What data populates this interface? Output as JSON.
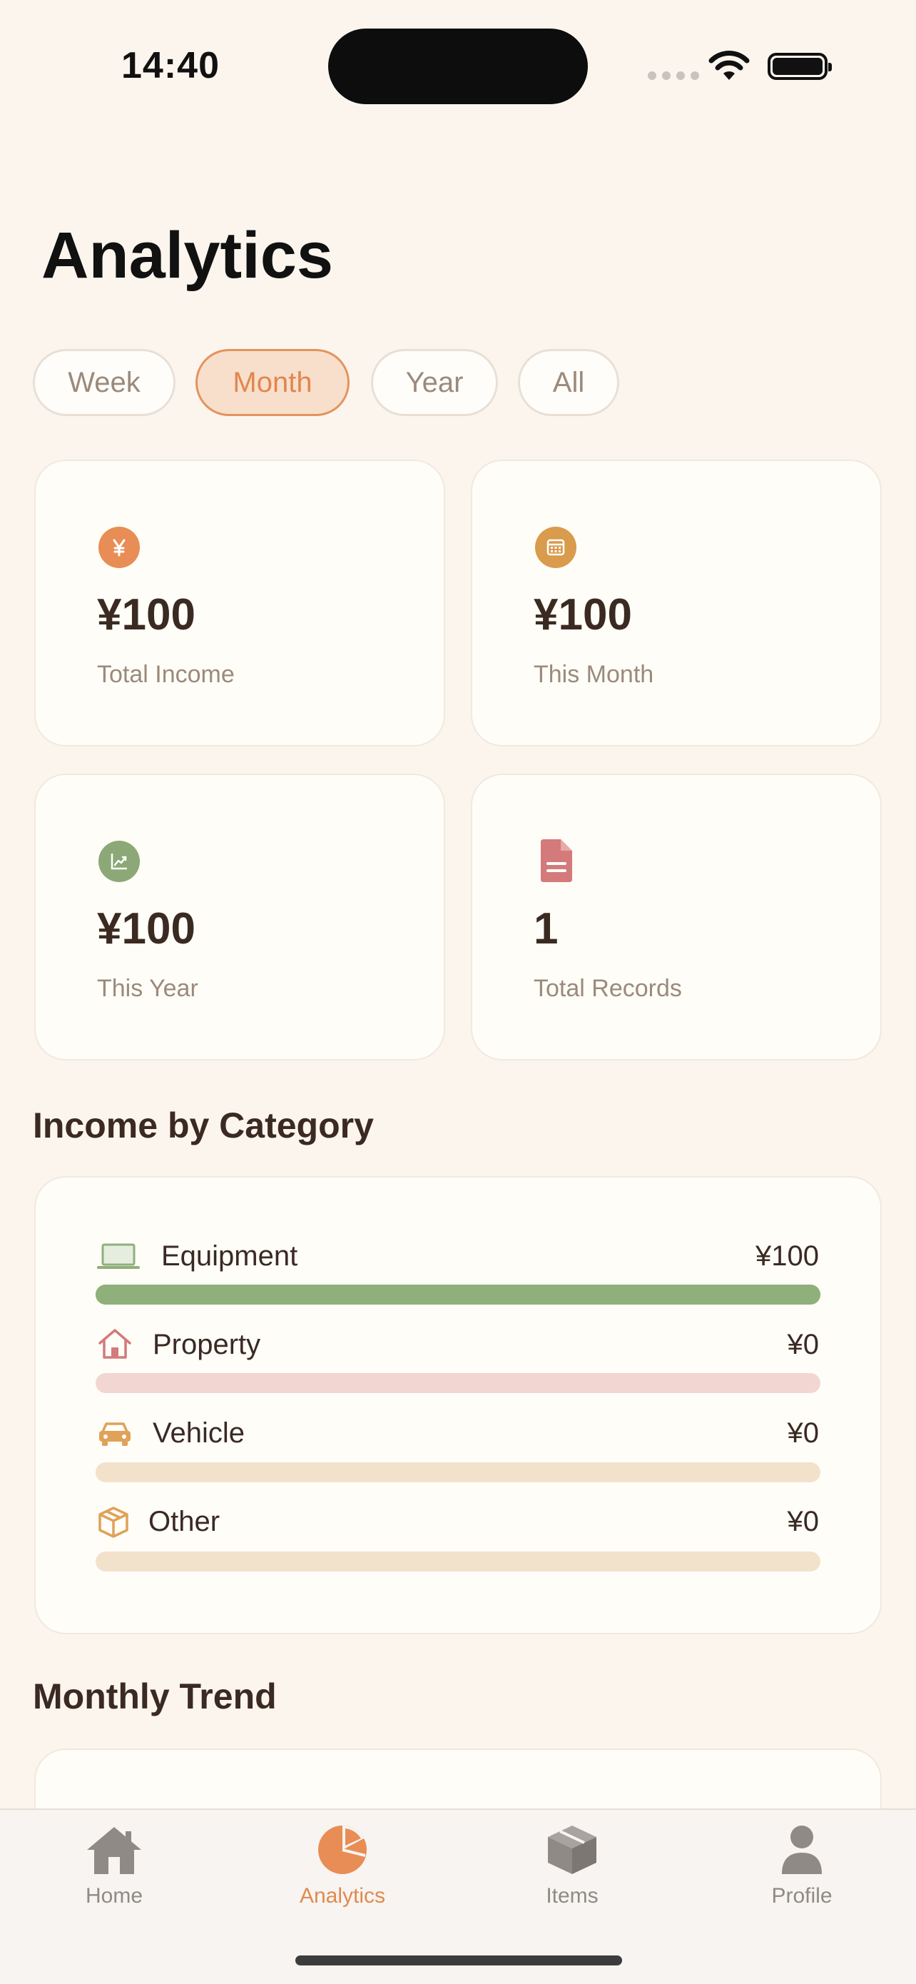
{
  "status_bar": {
    "time": "14:40"
  },
  "page": {
    "title": "Analytics"
  },
  "filters": [
    {
      "label": "Week",
      "selected": false
    },
    {
      "label": "Month",
      "selected": true
    },
    {
      "label": "Year",
      "selected": false
    },
    {
      "label": "All",
      "selected": false
    }
  ],
  "stats": [
    {
      "value": "¥100",
      "label": "Total Income",
      "icon": "yen-icon",
      "color": "#e88d55"
    },
    {
      "value": "¥100",
      "label": "This Month",
      "icon": "calendar-icon",
      "color": "#d99b4c"
    },
    {
      "value": "¥100",
      "label": "This Year",
      "icon": "trend-chart-icon",
      "color": "#8ba876"
    },
    {
      "value": "1",
      "label": "Total Records",
      "icon": "document-icon",
      "color": "#d47a7a"
    }
  ],
  "income_by_category": {
    "title": "Income by Category",
    "items": [
      {
        "name": "Equipment",
        "value": "¥100",
        "fraction": 1.0,
        "icon": "laptop-icon",
        "color": "#8fb07a",
        "track": "#8fb07a"
      },
      {
        "name": "Property",
        "value": "¥0",
        "fraction": 0.0,
        "icon": "house-icon",
        "color": "#d47a7a",
        "track": "#f1d6d2"
      },
      {
        "name": "Vehicle",
        "value": "¥0",
        "fraction": 0.0,
        "icon": "car-icon",
        "color": "#dfa258",
        "track": "#f2e2cb"
      },
      {
        "name": "Other",
        "value": "¥0",
        "fraction": 0.0,
        "icon": "box-icon",
        "color": "#dfa258",
        "track": "#f2e2cb"
      }
    ]
  },
  "monthly_trend": {
    "title": "Monthly Trend"
  },
  "tab_bar": [
    {
      "label": "Home",
      "icon": "home-icon",
      "active": false
    },
    {
      "label": "Analytics",
      "icon": "pie-chart-icon",
      "active": true
    },
    {
      "label": "Items",
      "icon": "box-icon",
      "active": false
    },
    {
      "label": "Profile",
      "icon": "person-icon",
      "active": false
    }
  ],
  "colors": {
    "background": "#fcf5ee",
    "accent": "#e88d55",
    "text": "#3a2a22",
    "muted": "#9b8a7c"
  }
}
